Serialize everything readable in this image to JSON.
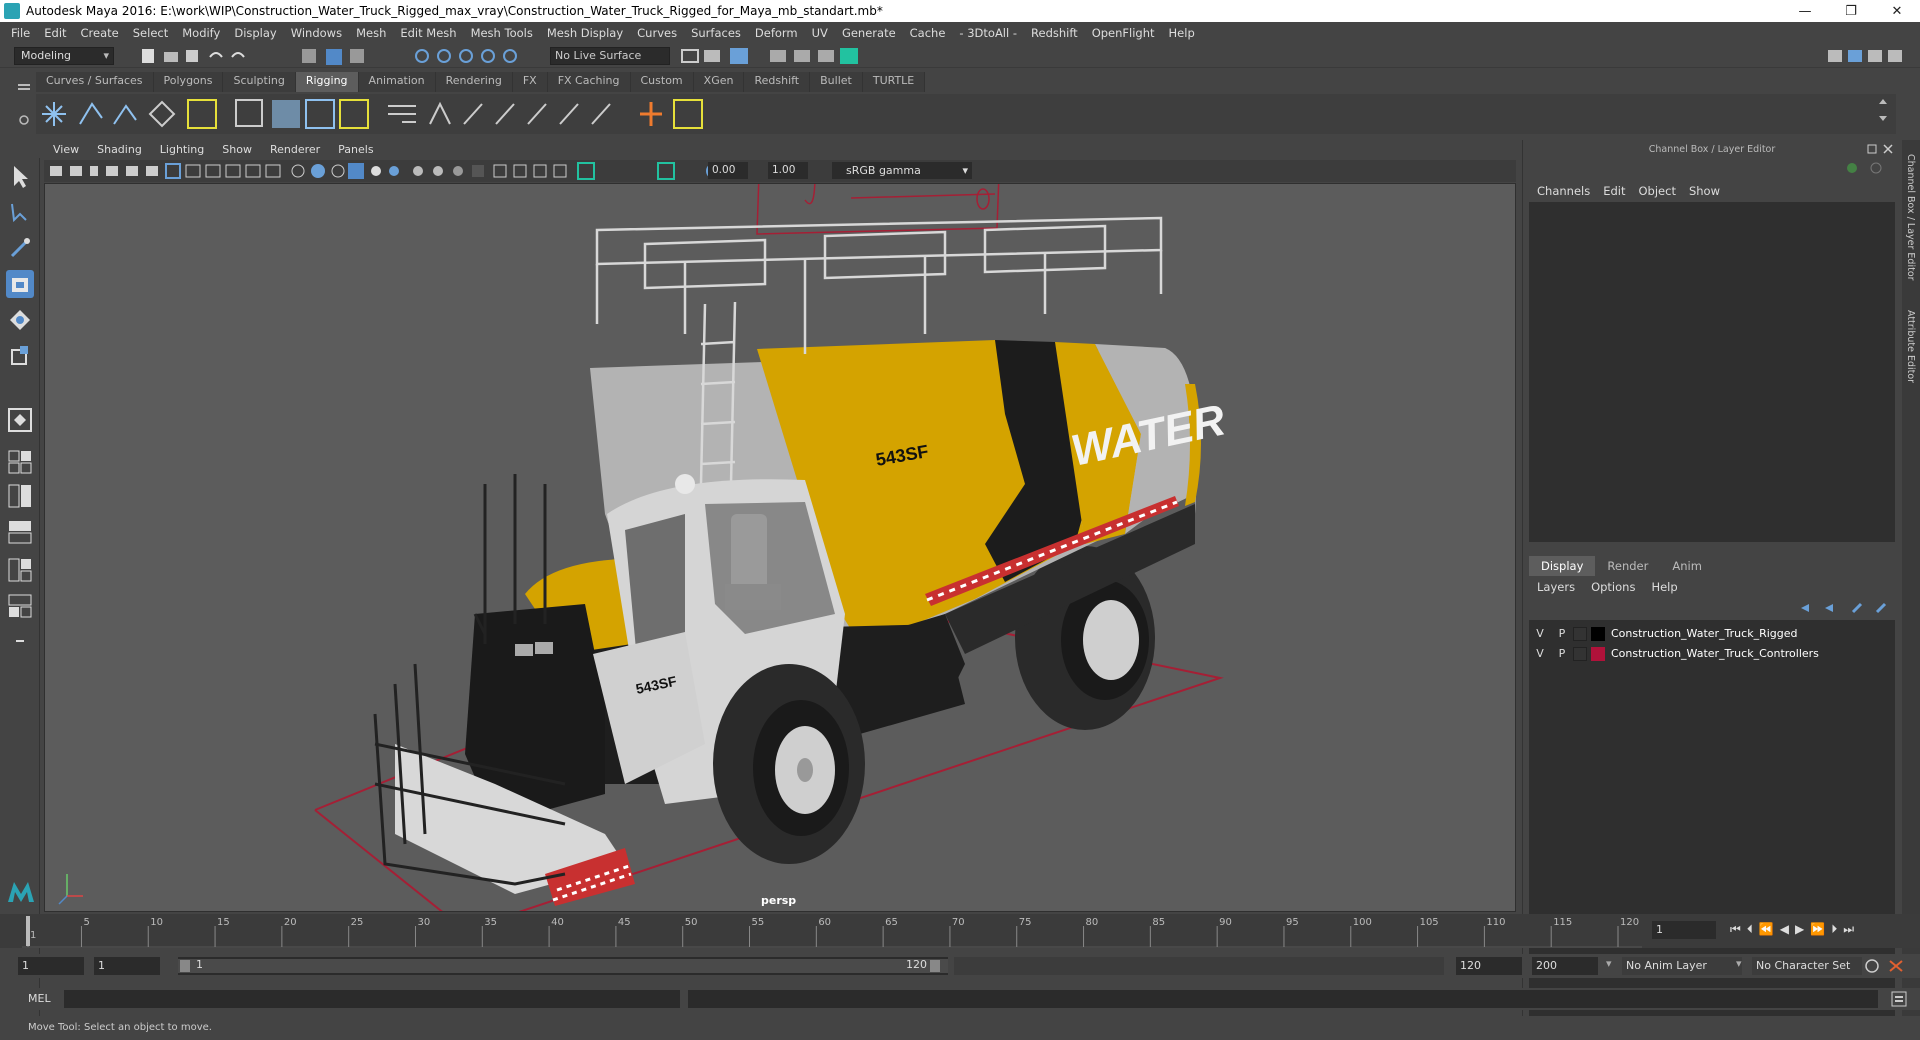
{
  "window": {
    "title": "Autodesk Maya 2016: E:\\work\\WIP\\Construction_Water_Truck_Rigged_max_vray\\Construction_Water_Truck_Rigged_for_Maya_mb_standart.mb*",
    "minimize": "—",
    "restore": "❐",
    "close": "✕"
  },
  "menubar": [
    "File",
    "Edit",
    "Create",
    "Select",
    "Modify",
    "Display",
    "Windows",
    "Mesh",
    "Edit Mesh",
    "Mesh Tools",
    "Mesh Display",
    "Curves",
    "Surfaces",
    "Deform",
    "UV",
    "Generate",
    "Cache",
    "- 3DtoAll -",
    "Redshift",
    "OpenFlight",
    "Help"
  ],
  "statusline": {
    "mode": "Modeling",
    "live_surface": "No Live Surface"
  },
  "shelf": {
    "tabs": [
      "Curves / Surfaces",
      "Polygons",
      "Sculpting",
      "Rigging",
      "Animation",
      "Rendering",
      "FX",
      "FX Caching",
      "Custom",
      "XGen",
      "Redshift",
      "Bullet",
      "TURTLE"
    ],
    "active_tab": "Rigging"
  },
  "viewport": {
    "menu": [
      "View",
      "Shading",
      "Lighting",
      "Show",
      "Renderer",
      "Panels"
    ],
    "near_value": "0.00",
    "gamma_value": "1.00",
    "color_space": "sRGB gamma",
    "camera_label": "persp",
    "truck_label_side": "WATER",
    "truck_label_code": "543SF"
  },
  "channel_box": {
    "title": "Channel Box / Layer Editor",
    "menu": [
      "Channels",
      "Edit",
      "Object",
      "Show"
    ]
  },
  "layer_editor": {
    "tabs": [
      "Display",
      "Render",
      "Anim"
    ],
    "active_tab": "Display",
    "menu": [
      "Layers",
      "Options",
      "Help"
    ],
    "layers": [
      {
        "v": "V",
        "p": "P",
        "name": "Construction_Water_Truck_Rigged",
        "color": "#000000"
      },
      {
        "v": "V",
        "p": "P",
        "name": "Construction_Water_Truck_Controllers",
        "color": "#b0123a"
      }
    ]
  },
  "side_tabs": [
    "Channel Box / Layer Editor",
    "Attribute Editor"
  ],
  "timeline": {
    "ticks": [
      "1",
      "5",
      "10",
      "15",
      "20",
      "25",
      "30",
      "35",
      "40",
      "45",
      "50",
      "55",
      "60",
      "65",
      "70",
      "75",
      "80",
      "85",
      "90",
      "95",
      "100",
      "105",
      "110",
      "115",
      "120"
    ],
    "current_frame": "1"
  },
  "range": {
    "start": "1",
    "playback_start": "1",
    "slider_start": "1",
    "slider_end": "120",
    "playback_end": "120",
    "end": "200",
    "anim_layer": "No Anim Layer",
    "character_set": "No Character Set"
  },
  "mel": {
    "label": "MEL"
  },
  "help_line": "Move Tool: Select an object to move."
}
